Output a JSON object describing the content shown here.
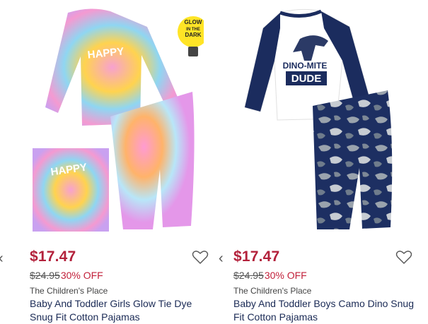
{
  "products": [
    {
      "price": "$17.47",
      "original_price": "$24.95",
      "discount": "30% OFF",
      "brand": "The Children's Place",
      "name": "Baby And Toddler Girls Glow Tie Dye Snug Fit Cotton Pajamas",
      "print_text": "HAPPY",
      "badge_lines": [
        "GLOW",
        "IN THE",
        "DARK"
      ],
      "image": "tie-dye-pajamas"
    },
    {
      "price": "$17.47",
      "original_price": "$24.95",
      "discount": "30% OFF",
      "brand": "The Children's Place",
      "name": "Baby And Toddler Boys Camo Dino Snug Fit Cotton Pajamas",
      "print_text_1": "DINO-MITE",
      "print_text_2": "DUDE",
      "image": "dino-camo-pajamas"
    }
  ],
  "icons": {
    "wishlist": "heart-outline-icon",
    "carousel_prev": "chevron-left-icon"
  },
  "colors": {
    "price": "#b3213b",
    "discount": "#c2203a",
    "name": "#1a2a55"
  }
}
